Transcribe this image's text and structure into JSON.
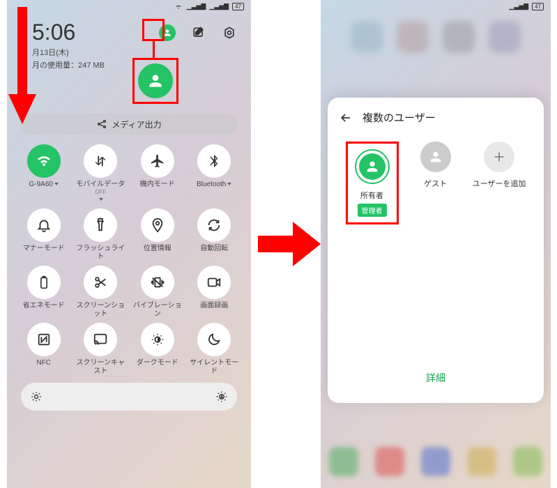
{
  "statusbar": {
    "battery": "47"
  },
  "left": {
    "time": "5:06",
    "date": "月13日(木)",
    "usage": "月の使用量：247 MB",
    "media": "メディア出力",
    "tiles": [
      {
        "label": "G-9A60",
        "active": true,
        "icon": "wifi",
        "dropdown": true
      },
      {
        "label": "モバイルデータ",
        "sub": "OFF",
        "icon": "data",
        "dropdown": true
      },
      {
        "label": "機内モード",
        "icon": "airplane"
      },
      {
        "label": "Bluetooth",
        "icon": "bluetooth",
        "dropdown": true
      },
      {
        "label": "マナーモード",
        "icon": "bell"
      },
      {
        "label": "フラッシュライト",
        "icon": "flashlight"
      },
      {
        "label": "位置情報",
        "icon": "location"
      },
      {
        "label": "自動回転",
        "icon": "rotate"
      },
      {
        "label": "省エネモード",
        "icon": "battery-saver"
      },
      {
        "label": "スクリーンショット",
        "icon": "screenshot"
      },
      {
        "label": "バイブレーション",
        "icon": "vibration"
      },
      {
        "label": "画面録画",
        "icon": "record"
      },
      {
        "label": "NFC",
        "icon": "nfc"
      },
      {
        "label": "スクリーンキャスト",
        "icon": "cast"
      },
      {
        "label": "ダークモード",
        "icon": "dark"
      },
      {
        "label": "サイレントモード",
        "icon": "silent"
      }
    ]
  },
  "right": {
    "modal_title": "複数のユーザー",
    "owner": "所有者",
    "owner_badge": "管理者",
    "guest": "ゲスト",
    "add": "ユーザーを追加",
    "detail": "詳細"
  },
  "icons": {
    "person": "person",
    "edit": "edit",
    "settings": "settings"
  }
}
